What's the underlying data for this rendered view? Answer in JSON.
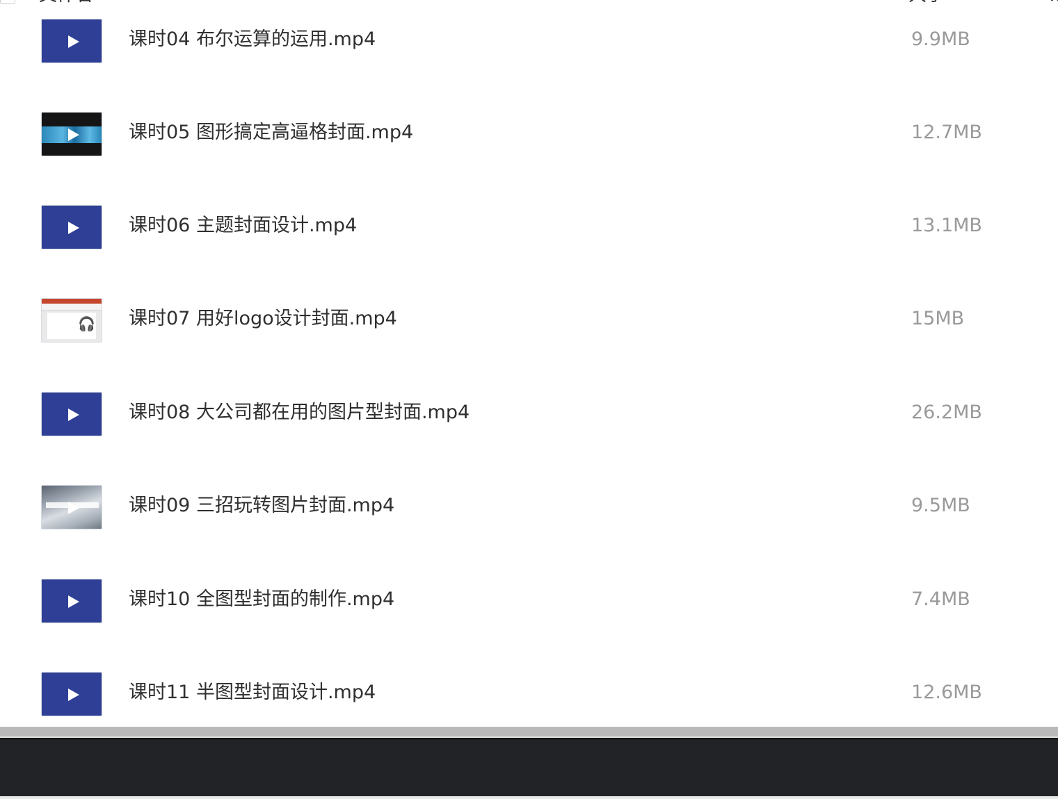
{
  "header": {
    "name_label": "文件名",
    "size_label": "大小",
    "extra_label": "…"
  },
  "files": [
    {
      "name": "课时04 布尔运算的运用.mp4",
      "size": "9.9MB",
      "thumbnail": "play-icon"
    },
    {
      "name": "课时05 图形搞定高逼格封面.mp4",
      "size": "12.7MB",
      "thumbnail": "video-frame-dark"
    },
    {
      "name": "课时06 主题封面设计.mp4",
      "size": "13.1MB",
      "thumbnail": "play-icon"
    },
    {
      "name": "课时07 用好logo设计封面.mp4",
      "size": "15MB",
      "thumbnail": "video-frame-slide"
    },
    {
      "name": "课时08 大公司都在用的图片型封面.mp4",
      "size": "26.2MB",
      "thumbnail": "play-icon"
    },
    {
      "name": "课时09 三招玩转图片封面.mp4",
      "size": "9.5MB",
      "thumbnail": "video-frame-photo"
    },
    {
      "name": "课时10 全图型封面的制作.mp4",
      "size": "7.4MB",
      "thumbnail": "play-icon"
    },
    {
      "name": "课时11 半图型封面设计.mp4",
      "size": "12.6MB",
      "thumbnail": "play-icon"
    }
  ],
  "colors": {
    "thumbnail_blue": "#2e3f95",
    "file_name_text": "#2f2f2f",
    "file_size_text": "#9a9a9a",
    "bottom_panel": "#222326"
  }
}
